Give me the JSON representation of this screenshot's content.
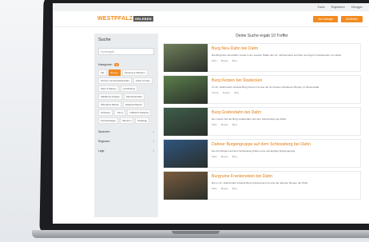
{
  "topbar": {
    "links": [
      "Suche",
      "Registrieren",
      "Einloggen"
    ]
  },
  "header": {
    "logo_text": "WESTPFALZ",
    "logo_suffix": "ERLEBEN",
    "btn_primary": "Ihre Anfrage",
    "btn_secondary": "Schließen"
  },
  "sidebar": {
    "title": "Suche",
    "search_placeholder": "Suchbegriff",
    "categories_label": "Kategorien",
    "categories_count": "8",
    "tags": [
      "Alle",
      "Burgen",
      "Camping & Wandern",
      "Kirchen und Kunstdenkmäler",
      "Kultur & Feste",
      "Natur & Wasser",
      "Landhüttung",
      "Städtische Anlagen",
      "Naturdenkmäler",
      "Öffentliche Bauten",
      "Religiöse Bauten",
      "Schlösser",
      "Türme",
      "UNESCO Welterbe",
      "Freizeitanlagen",
      "Wandern",
      "Radwege"
    ],
    "active_tag": "Burgen",
    "rows": [
      "Sprachen",
      "Regionen",
      "Lage"
    ]
  },
  "main": {
    "heading": "Deine Suche ergab 10 Treffer",
    "results": [
      {
        "title": "Burg Neu-Dahn bei Dahn",
        "text": "Die Burgruine Neu-Dahn wurde in der zweiten Hälfte des 13. Jahrhunderts errichtet und liegt im Nordwesten von Dahn.",
        "meta": [
          "Dahn",
          "Burgen",
          "Burg"
        ]
      },
      {
        "title": "Burg Kerpen bei Stadecken",
        "text": "Im 12. Jahrhundert erbaute Burg Kerpen ist eine der am besten erhaltenen Burgen im Westerwald.",
        "meta": [
          "Kerpen",
          "Burgen",
          "Burg"
        ]
      },
      {
        "title": "Burg Grafendahn bei Dahn",
        "text": "Der zweite Teil der Burg Grafendahn auf dem Schlossberg bei Dahn.",
        "meta": [
          "Dahn",
          "Burgen",
          "Burg"
        ]
      },
      {
        "title": "Dahner Burgengruppe auf dem Schlossberg bei Dahn",
        "text": "Die drei Burgen auf dem Schlossberg bilden eine einzigartige Burgengruppe.",
        "meta": [
          "Dahn",
          "Burgen",
          "Burg"
        ]
      },
      {
        "title": "Burgruine Frankenstein bei Dahn",
        "text": "Die im 11. Jahrhundert erbaute Burg Frankenstein ist eine der ältesten Burgen der Pfalz.",
        "meta": [
          "Dahn",
          "Burgen",
          "Burg"
        ]
      }
    ]
  }
}
